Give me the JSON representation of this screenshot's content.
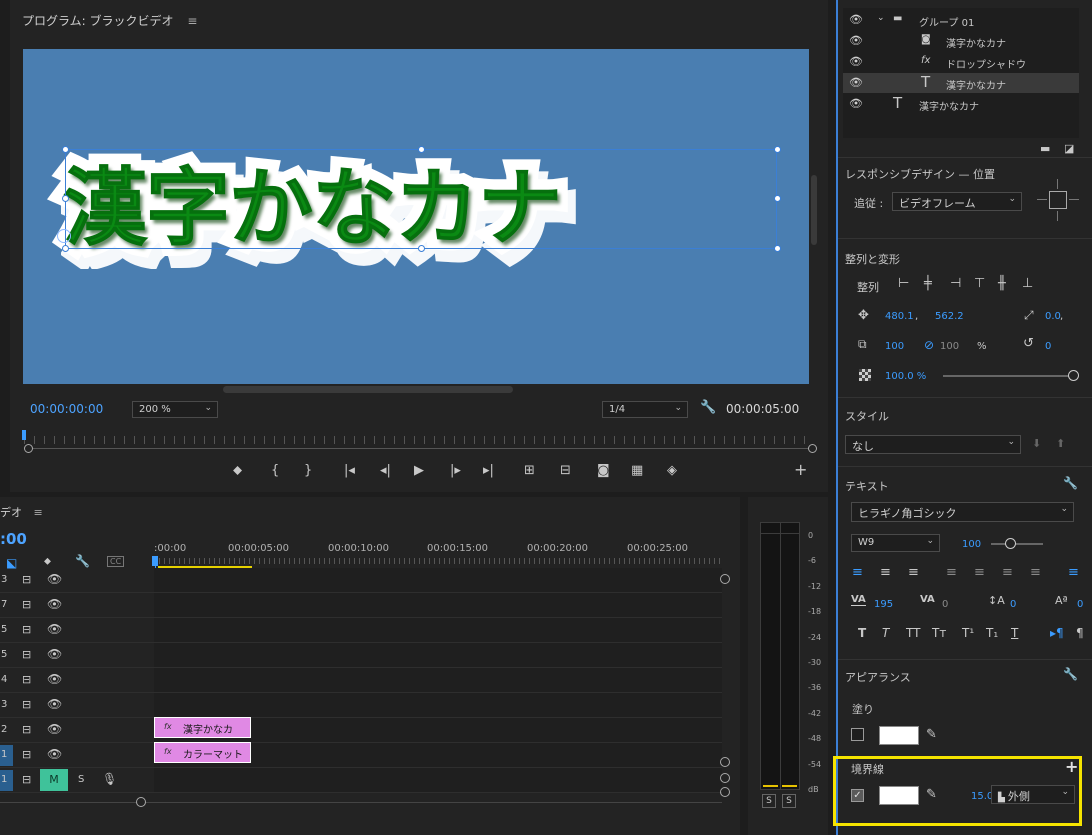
{
  "program": {
    "title": "プログラム: ブラックビデオ",
    "menu_icon": "hamburger-icon",
    "video_text": "漢字かなカナ",
    "timecode_current": "00:00:00:00",
    "zoom": "200 %",
    "resolution": "1/4",
    "timecode_duration": "00:00:05:00",
    "video_bg_color": "#4a7eb1",
    "text_fill_color": "#0a8a13",
    "text_stroke_color": "#ffffff"
  },
  "transport": {
    "icons": [
      "marker-icon",
      "mark-in-icon",
      "mark-out-icon",
      "go-to-in-icon",
      "step-back-icon",
      "play-icon",
      "step-forward-icon",
      "go-to-out-icon",
      "lift-icon",
      "extract-icon",
      "export-frame-icon",
      "compare-icon",
      "multi-cam-icon",
      "add-button-icon"
    ]
  },
  "timeline": {
    "title": "デオ",
    "timecode": ":00",
    "ruler": [
      ":00:00",
      "00:00:05:00",
      "00:00:10:00",
      "00:00:15:00",
      "00:00:20:00",
      "00:00:25:00"
    ],
    "track_letters": [
      "3",
      "7",
      "5",
      "5",
      "4",
      "3",
      "2",
      "1",
      "1"
    ],
    "clips": [
      {
        "label": "漢字かなカ",
        "track": 6
      },
      {
        "label": "カラーマット",
        "track": 7
      }
    ],
    "mute_label": "M",
    "solo_label": "S",
    "cc_label": "CC"
  },
  "meter": {
    "scale": [
      "0",
      "-6",
      "-12",
      "-18",
      "-24",
      "-30",
      "-36",
      "-42",
      "-48",
      "-54",
      "dB"
    ],
    "solo_left": "S",
    "solo_right": "S"
  },
  "layers": [
    {
      "name": "グループ 01",
      "icon": "folder-icon",
      "indent": 0
    },
    {
      "name": "漢字かなカナ",
      "icon": "mask-icon",
      "indent": 1
    },
    {
      "name": "ドロップシャドウ",
      "icon": "fx-icon",
      "indent": 1
    },
    {
      "name": "漢字かなカナ",
      "icon": "text-icon",
      "indent": 1
    },
    {
      "name": "漢字かなカナ",
      "icon": "text-icon",
      "indent": 0
    }
  ],
  "responsive": {
    "title": "レスポンシブデザイン — 位置",
    "follow_label": "追従 :",
    "follow_value": "ビデオフレーム"
  },
  "align": {
    "title": "整列と変形",
    "align_label": "整列",
    "position_x": "480.1",
    "position_sep": ",",
    "position_y": "562.2",
    "anchor_x": "0.0",
    "anchor_sep": ",",
    "scale": "100",
    "scale_linked": "100",
    "percent": "%",
    "rotation": "0",
    "opacity": "100.0 %"
  },
  "style": {
    "title": "スタイル",
    "value": "なし"
  },
  "text": {
    "title": "テキスト",
    "font": "ヒラギノ角ゴシック",
    "weight": "W9",
    "size": "100",
    "tracking": "195",
    "kerning": "0",
    "leading": "0",
    "baseline": "0",
    "style_buttons": [
      "T",
      "T",
      "TT",
      "Tт",
      "T¹",
      "T₁",
      "T"
    ]
  },
  "appearance": {
    "title": "アピアランス",
    "fill_label": "塗り",
    "stroke_label": "境界線",
    "stroke_width": "15.0",
    "stroke_position": "外側",
    "fill_color": "#ffffff",
    "stroke_color": "#ffffff",
    "highlight_color": "#f5e400"
  }
}
